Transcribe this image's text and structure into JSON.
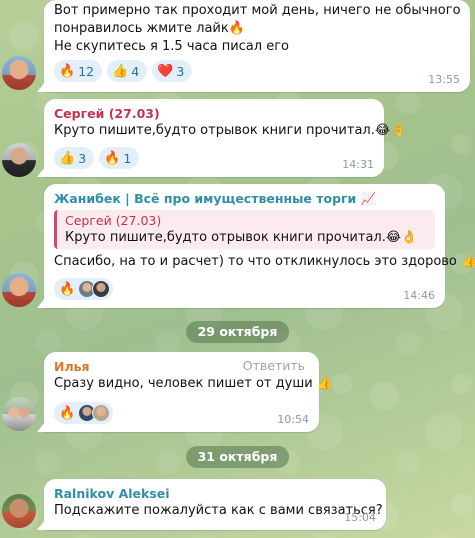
{
  "messages": [
    {
      "id": "m1",
      "lines": [
        "Вот примерно так проходит мой день, ничего не обычного",
        "понравилось жмите лайк🔥",
        "Не скупитесь я 1.5 часа писал его"
      ],
      "reactions": [
        {
          "emoji": "🔥",
          "count": "12"
        },
        {
          "emoji": "👍",
          "count": "4"
        },
        {
          "emoji": "❤️",
          "count": "3"
        }
      ],
      "time": "13:55"
    },
    {
      "id": "m2",
      "sender": "Сергей (27.03)",
      "sender_color": "#c2334d",
      "text": "Круто пишите,будто отрывок книги прочитал.😂👌",
      "reactions": [
        {
          "emoji": "👍",
          "count": "3"
        },
        {
          "emoji": "🔥",
          "count": "1"
        }
      ],
      "time": "14:31"
    },
    {
      "id": "m3",
      "sender": "Жанибек | Всё про имущественные торги 📈",
      "sender_color": "#2f8fa8",
      "quote_sender": "Сергей (27.03)",
      "quote_text": "Круто пишите,будто отрывок книги прочитал.😂👌",
      "text": "Спасибо, на то и расчет) то что откликнулось это здорово 👍",
      "reactions": [
        {
          "emoji": "🔥"
        }
      ],
      "time": "14:46"
    },
    {
      "id": "m4",
      "sender": "Илья",
      "sender_color": "#d9782b",
      "reply_label": "Ответить",
      "text": "Сразу видно, человек пишет от души 👍",
      "reactions": [
        {
          "emoji": "🔥"
        }
      ],
      "time": "10:54"
    },
    {
      "id": "m5",
      "sender": "Ralnikov Aleksei",
      "sender_color": "#2f8fa8",
      "text": "Подскажите пожалуйста как с вами связаться?",
      "time": "15:04"
    }
  ],
  "dates": [
    "29 октября",
    "31 октября"
  ],
  "colors": {
    "reaction_bg": "#e2eff8",
    "reaction_text": "#2a6ea5",
    "quote_bg": "#fbeaee",
    "quote_bar": "#d1496b"
  }
}
